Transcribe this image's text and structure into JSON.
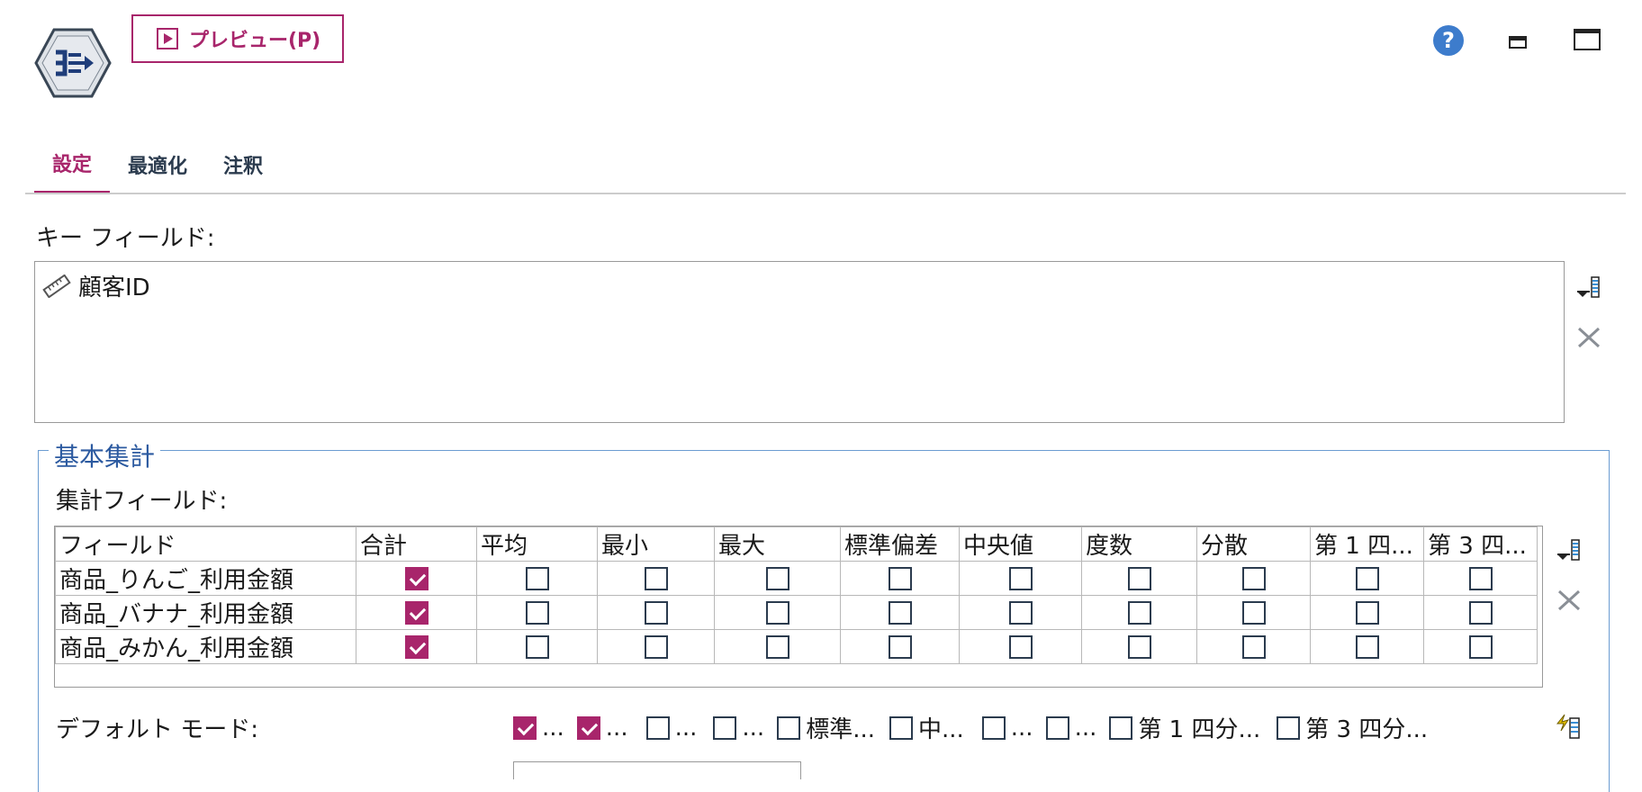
{
  "header": {
    "preview_label": "プレビュー(P)",
    "help_glyph": "?"
  },
  "tabs": [
    {
      "label": "設定",
      "active": true
    },
    {
      "label": "最適化",
      "active": false
    },
    {
      "label": "注釈",
      "active": false
    }
  ],
  "key_fields": {
    "label": "キー フィールド:",
    "items": [
      "顧客ID"
    ]
  },
  "basic_agg": {
    "title": "基本集計",
    "agg_fields_label": "集計フィールド:",
    "columns": [
      "フィールド",
      "合計",
      "平均",
      "最小",
      "最大",
      "標準偏差",
      "中央値",
      "度数",
      "分散",
      "第 1 四...",
      "第 3 四..."
    ],
    "rows": [
      {
        "field": "商品_りんご_利用金額",
        "checks": [
          true,
          false,
          false,
          false,
          false,
          false,
          false,
          false,
          false,
          false
        ]
      },
      {
        "field": "商品_バナナ_利用金額",
        "checks": [
          true,
          false,
          false,
          false,
          false,
          false,
          false,
          false,
          false,
          false
        ]
      },
      {
        "field": "商品_みかん_利用金額",
        "checks": [
          true,
          false,
          false,
          false,
          false,
          false,
          false,
          false,
          false,
          false
        ]
      }
    ],
    "default_mode": {
      "label": "デフォルト モード:",
      "items": [
        {
          "label": "...",
          "checked": true
        },
        {
          "label": "...",
          "checked": true
        },
        {
          "label": "...",
          "checked": false
        },
        {
          "label": "...",
          "checked": false
        },
        {
          "label": "標準...",
          "checked": false
        },
        {
          "label": "中...",
          "checked": false
        },
        {
          "label": "...",
          "checked": false
        },
        {
          "label": "...",
          "checked": false
        },
        {
          "label": "第 1 四分...",
          "checked": false
        },
        {
          "label": "第 3 四分...",
          "checked": false
        }
      ]
    }
  },
  "colors": {
    "accent": "#a8256b",
    "group_border": "#6b9cd1",
    "group_title": "#2c5aa0",
    "help": "#3d7ccc"
  }
}
